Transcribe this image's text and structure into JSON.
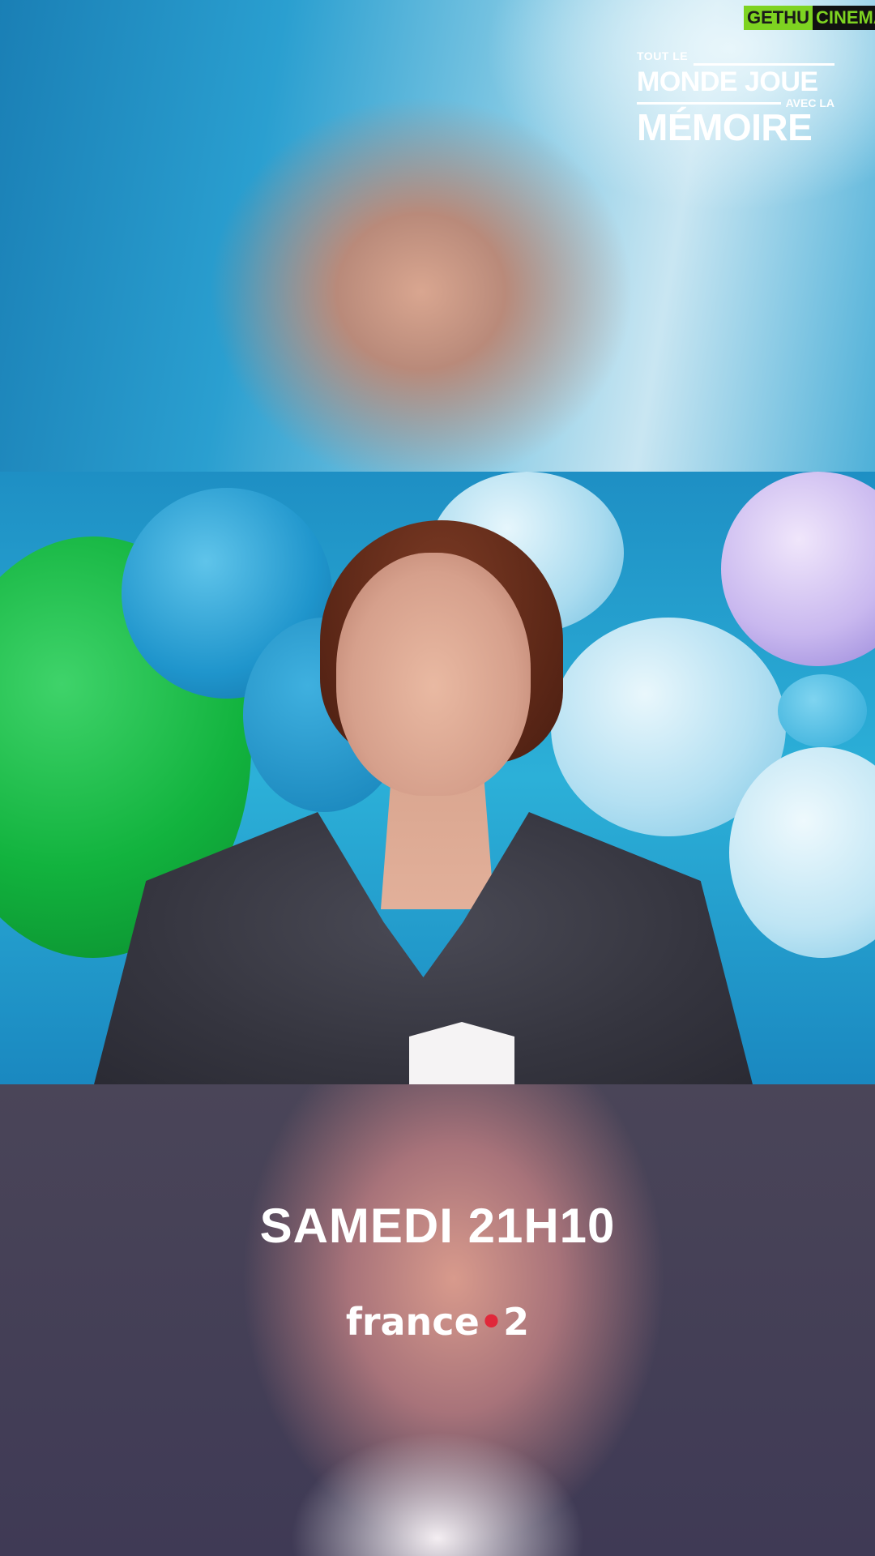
{
  "watermark": {
    "part1": "GETHU",
    "part2": "CINEMA"
  },
  "show_logo": {
    "line1": "TOUT LE",
    "line2": "MONDE JOUE",
    "line3": "AVEC LA",
    "line4": "MÉMOIRE"
  },
  "broadcast": {
    "time": "SAMEDI 21H10"
  },
  "channel": {
    "name": "france",
    "number": "2",
    "dot_color": "#e0283a"
  }
}
